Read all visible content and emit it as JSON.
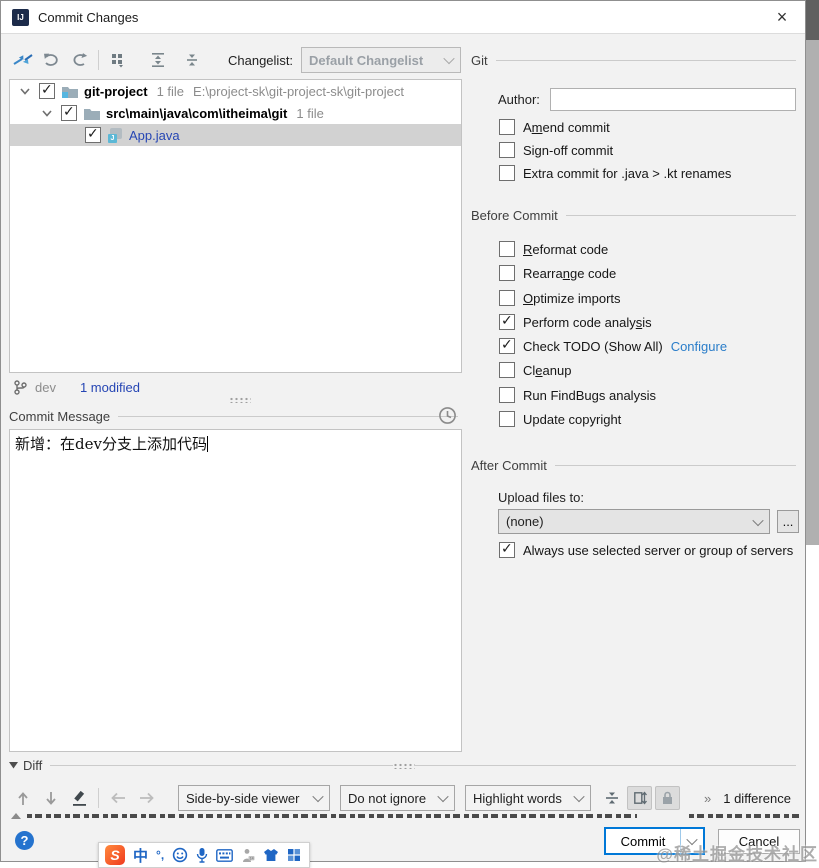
{
  "window": {
    "title": "Commit Changes",
    "close": "×"
  },
  "toolbar": {
    "changelist_label": "Changelist:",
    "changelist_value": "Default Changelist",
    "icons": [
      "commit-arrows-icon",
      "rollback-icon",
      "refresh-icon",
      "group-by-icon",
      "expand-all-icon",
      "collapse-all-icon"
    ]
  },
  "tree": {
    "rows": [
      {
        "name": "git-project",
        "meta": "1 file",
        "path": "E:\\project-sk\\git-project-sk\\git-project"
      },
      {
        "name": "src\\main\\java\\com\\itheima\\git",
        "meta": "1 file"
      },
      {
        "name": "App.java"
      }
    ]
  },
  "status": {
    "branch": "dev",
    "modified": "1 modified"
  },
  "commit_message": {
    "header": "Commit Message",
    "text": "新增：在dev分支上添加代码"
  },
  "git_section": {
    "title": "Git",
    "author_label": "Author:",
    "author_value": "",
    "checkboxes": [
      {
        "label": "A&mend commit",
        "checked": false
      },
      {
        "label": "Sign-off commit",
        "checked": false
      },
      {
        "label": "Extra commit for .java > .kt renames",
        "checked": false
      }
    ]
  },
  "before_commit": {
    "title": "Before Commit",
    "checkboxes": [
      {
        "label": "&Reformat code",
        "checked": false
      },
      {
        "label": "Rearra&nge code",
        "checked": false
      },
      {
        "label": "&Optimize imports",
        "checked": false
      },
      {
        "label": "Perform code analy&sis",
        "checked": true
      },
      {
        "label": "Check TODO (Show All)",
        "checked": true,
        "link": "Configure"
      },
      {
        "label": "Cl&eanup",
        "checked": false
      },
      {
        "label": "Run FindBugs analysis",
        "checked": false
      },
      {
        "label": "Update copyright",
        "checked": false
      }
    ]
  },
  "after_commit": {
    "title": "After Commit",
    "upload_label": "Upload files to:",
    "upload_value": "(none)",
    "more_button": "...",
    "always_checkbox": {
      "label": "Always use selected server or group of servers",
      "checked": true
    }
  },
  "diff": {
    "title": "Diff",
    "viewer_dropdown": "Side-by-side viewer",
    "ignore_dropdown": "Do not ignore",
    "highlight_dropdown": "Highlight words",
    "chevrons": "»",
    "difference_count": "1 difference"
  },
  "footer": {
    "commit": "Commit",
    "cancel": "Cancel",
    "help": "?"
  },
  "ime": {
    "logo": "S",
    "lang": "中",
    "punct": "°,"
  },
  "watermark": "@稀土掘金技术社区",
  "colors": {
    "accent": "#0078d7",
    "link": "#2a7dc9",
    "selection": "#d2d2d2",
    "file_blue": "#2646b4"
  }
}
